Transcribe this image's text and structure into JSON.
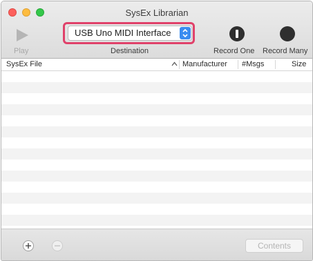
{
  "window": {
    "title": "SysEx Librarian"
  },
  "toolbar": {
    "play_label": "Play",
    "destination_label": "Destination",
    "destination_value": "USB Uno MIDI Interface",
    "record_one_label": "Record One",
    "record_many_label": "Record Many"
  },
  "table": {
    "columns": [
      "SysEx File",
      "Manufacturer",
      "#Msgs",
      "Size"
    ],
    "sort_indicator": "^",
    "rows": []
  },
  "bottom": {
    "add_icon": "plus-icon",
    "remove_icon": "minus-icon",
    "contents_label": "Contents"
  },
  "colors": {
    "highlight": "#e0416a",
    "popup_accent": "#3a8cf0",
    "close": "#fc605c",
    "minimize": "#fdbc40",
    "zoom": "#34c84a"
  }
}
